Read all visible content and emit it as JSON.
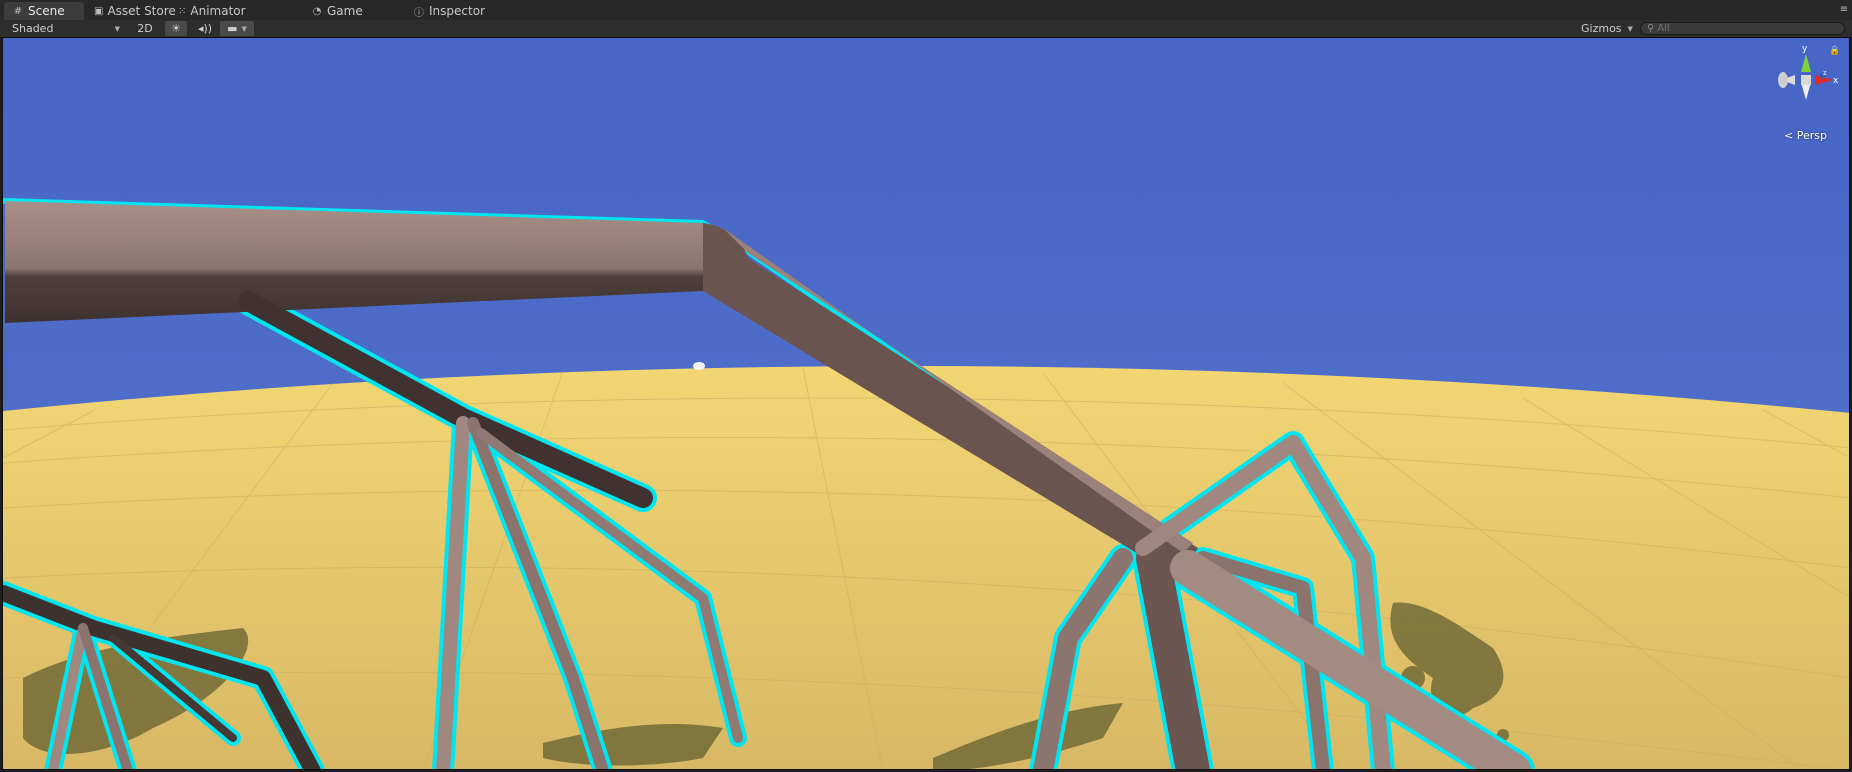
{
  "tabs": [
    {
      "label": "Scene",
      "icon": "grid-icon",
      "active": true
    },
    {
      "label": "Asset Store",
      "icon": "bag-icon"
    },
    {
      "label": "Animator",
      "icon": "animator-icon"
    },
    {
      "label": "Game",
      "icon": "pacman-icon"
    },
    {
      "label": "Inspector",
      "icon": "info-icon"
    }
  ],
  "toolbar": {
    "shading_mode": "Shaded",
    "mode_2d": "2D",
    "gizmos_label": "Gizmos",
    "search_placeholder": "All"
  },
  "scene": {
    "projection_label": "Persp",
    "axes": {
      "y": "y",
      "x": "x",
      "z": "z"
    },
    "colors": {
      "sky": "#4b6ac8",
      "ground": "#ecd070",
      "mesh": "#a08880",
      "mesh_dark": "#4b3c39",
      "selection": "#00e5ee",
      "shadow": "#5a5c2c"
    }
  }
}
